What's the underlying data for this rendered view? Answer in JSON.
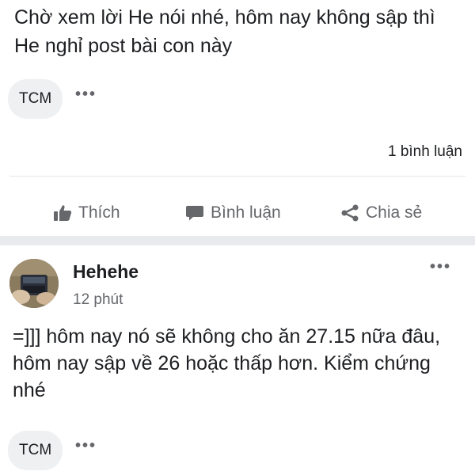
{
  "post": {
    "text": "Chờ xem lời He nói nhé, hôm nay không sập thì He nghỉ post bài con này",
    "tag": "TCM",
    "more": "•••",
    "comment_count": "1 bình luận"
  },
  "actions": {
    "like": "Thích",
    "comment": "Bình luận",
    "share": "Chia sẻ"
  },
  "comment": {
    "author": "Hehehe",
    "time": "12 phút",
    "more": "•••",
    "text": "=]]] hôm nay nó sẽ không cho ăn 27.15 nữa đâu, hôm nay sập về 26 hoặc thấp hơn. Kiểm chứng nhé",
    "tag": "TCM",
    "tag_more": "•••"
  },
  "colors": {
    "text": "#1c1e21",
    "muted": "#65676b",
    "pill": "#eff0f2"
  }
}
